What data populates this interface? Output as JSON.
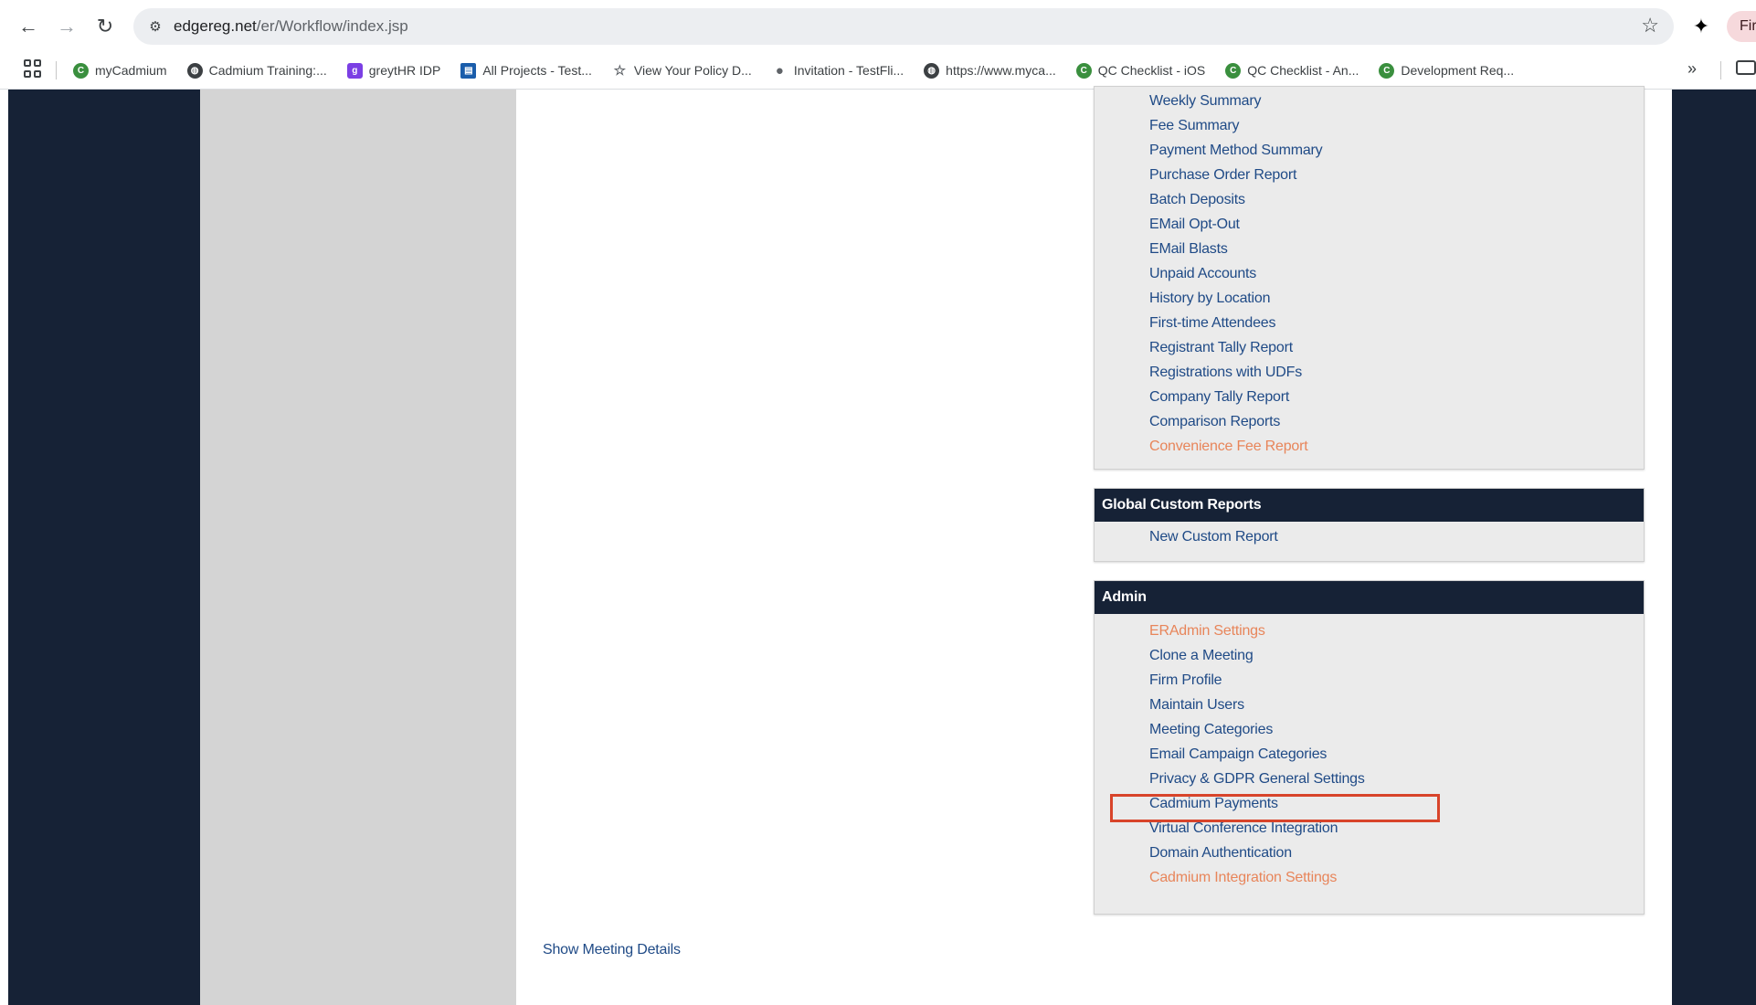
{
  "browser": {
    "url_host": "edgereg.net",
    "url_path": "/er/Workflow/index.jsp",
    "profile_label": "Fir",
    "bookmarks": [
      {
        "label": "myCadmium",
        "icon": "green-logo-icon"
      },
      {
        "label": "Cadmium Training:...",
        "icon": "globe-icon"
      },
      {
        "label": "greytHR IDP",
        "icon": "greythr-icon"
      },
      {
        "label": "All Projects - Test...",
        "icon": "project-icon"
      },
      {
        "label": "View Your Policy D...",
        "icon": "cursor-icon"
      },
      {
        "label": "Invitation - TestFli...",
        "icon": "apple-icon"
      },
      {
        "label": "https://www.myca...",
        "icon": "globe-icon"
      },
      {
        "label": "QC Checklist - iOS",
        "icon": "green-logo-icon"
      },
      {
        "label": "QC Checklist - An...",
        "icon": "green-logo-icon"
      },
      {
        "label": "Development Req...",
        "icon": "green-logo-icon"
      }
    ],
    "more_label": "»"
  },
  "reports_panel": {
    "links": [
      {
        "label": "Weekly Summary",
        "color": "#1f4a86"
      },
      {
        "label": "Fee Summary",
        "color": "#1f4a86"
      },
      {
        "label": "Payment Method Summary",
        "color": "#1f4a86"
      },
      {
        "label": "Purchase Order Report",
        "color": "#1f4a86"
      },
      {
        "label": "Batch Deposits",
        "color": "#1f4a86"
      },
      {
        "label": "EMail Opt-Out",
        "color": "#1f4a86"
      },
      {
        "label": "EMail Blasts",
        "color": "#1f4a86"
      },
      {
        "label": "Unpaid Accounts",
        "color": "#1f4a86"
      },
      {
        "label": "History by Location",
        "color": "#1f4a86"
      },
      {
        "label": "First-time Attendees",
        "color": "#1f4a86"
      },
      {
        "label": "Registrant Tally Report",
        "color": "#1f4a86"
      },
      {
        "label": "Registrations with UDFs",
        "color": "#1f4a86"
      },
      {
        "label": "Company Tally Report",
        "color": "#1f4a86"
      },
      {
        "label": "Comparison Reports",
        "color": "#1f4a86"
      },
      {
        "label": "Convenience Fee Report",
        "color": "#e8855a"
      }
    ]
  },
  "global_custom_reports": {
    "title": "Global Custom Reports",
    "links": [
      {
        "label": "New Custom Report"
      }
    ]
  },
  "admin": {
    "title": "Admin",
    "links": [
      {
        "label": "ERAdmin Settings",
        "color": "#e8855a"
      },
      {
        "label": "Clone a Meeting",
        "color": "#1f4a86"
      },
      {
        "label": "Firm Profile",
        "color": "#1f4a86"
      },
      {
        "label": "Maintain Users",
        "color": "#1f4a86"
      },
      {
        "label": "Meeting Categories",
        "color": "#1f4a86"
      },
      {
        "label": "Email Campaign Categories",
        "color": "#1f4a86"
      },
      {
        "label": "Privacy & GDPR General Settings",
        "color": "#1f4a86"
      },
      {
        "label": "Cadmium Payments",
        "color": "#1f4a86",
        "highlighted": true
      },
      {
        "label": "Virtual Conference Integration",
        "color": "#1f4a86"
      },
      {
        "label": "Domain Authentication",
        "color": "#1f4a86"
      },
      {
        "label": "Cadmium Integration Settings",
        "color": "#e8855a"
      }
    ]
  },
  "show_meeting_details": "Show Meeting Details",
  "colors": {
    "navy": "#162236",
    "link_blue": "#1f4a86",
    "link_orange": "#e8855a",
    "highlight_red": "#d8442a"
  }
}
